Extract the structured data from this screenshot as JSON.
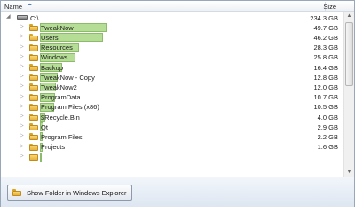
{
  "header": {
    "name_label": "Name",
    "size_label": "Size"
  },
  "rows": [
    {
      "name": "C:\\",
      "size": "234.3 GB",
      "type": "drive",
      "level": 0,
      "expanded": true,
      "bar_fraction": 0
    },
    {
      "name": "TweakNow",
      "size": "49.7 GB",
      "type": "folder",
      "level": 1,
      "bar_fraction": 0.212
    },
    {
      "name": "Users",
      "size": "46.2 GB",
      "type": "folder",
      "level": 1,
      "bar_fraction": 0.197
    },
    {
      "name": "Resources",
      "size": "28.3 GB",
      "type": "folder",
      "level": 1,
      "bar_fraction": 0.121
    },
    {
      "name": "Windows",
      "size": "25.8 GB",
      "type": "folder",
      "level": 1,
      "bar_fraction": 0.11
    },
    {
      "name": "Backup",
      "size": "16.4 GB",
      "type": "folder",
      "level": 1,
      "bar_fraction": 0.07
    },
    {
      "name": "TweakNow - Copy",
      "size": "12.8 GB",
      "type": "folder",
      "level": 1,
      "bar_fraction": 0.055
    },
    {
      "name": "TweakNow2",
      "size": "12.0 GB",
      "type": "folder",
      "level": 1,
      "bar_fraction": 0.051
    },
    {
      "name": "ProgramData",
      "size": "10.7 GB",
      "type": "folder",
      "level": 1,
      "bar_fraction": 0.046
    },
    {
      "name": "Program Files (x86)",
      "size": "10.5 GB",
      "type": "folder",
      "level": 1,
      "bar_fraction": 0.045
    },
    {
      "name": "$Recycle.Bin",
      "size": "4.0 GB",
      "type": "folder",
      "level": 1,
      "bar_fraction": 0.017
    },
    {
      "name": "Qt",
      "size": "2.9 GB",
      "type": "folder",
      "level": 1,
      "bar_fraction": 0.012
    },
    {
      "name": "Program Files",
      "size": "2.2 GB",
      "type": "folder",
      "level": 1,
      "bar_fraction": 0.009
    },
    {
      "name": "Projects",
      "size": "1.6 GB",
      "type": "folder",
      "level": 1,
      "bar_fraction": 0.007
    },
    {
      "name": "",
      "size": "",
      "type": "folder",
      "level": 1,
      "bar_fraction": 0.003
    }
  ],
  "footer": {
    "button_label": "Show Folder in Windows Explorer"
  },
  "icons": {
    "expanded": "triangle-down-icon",
    "collapsed": "triangle-right-icon",
    "sort": "sort-ascending-icon",
    "drive": "hard-drive-icon",
    "folder": "folder-icon"
  },
  "colors": {
    "bar_fill": "#a9d884",
    "bar_border": "#78b04f",
    "folder": "#f2c65a",
    "footer_bg": "#dde6f1",
    "sort_arrow": "#3b6fb6"
  }
}
